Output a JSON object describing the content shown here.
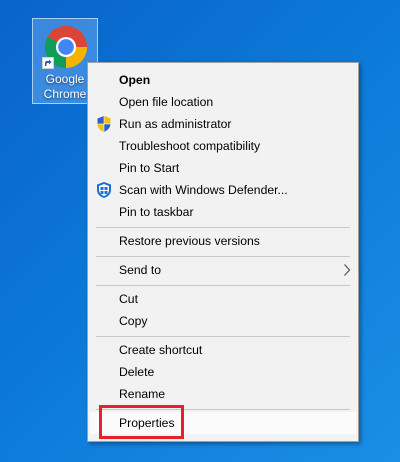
{
  "desktop": {
    "shortcut": {
      "label": "Google\nChrome",
      "icon": "chrome-icon",
      "overlay_icon": "shortcut-arrow-icon"
    }
  },
  "context_menu": {
    "items": [
      {
        "label": "Open",
        "bold": true
      },
      {
        "label": "Open file location"
      },
      {
        "label": "Run as administrator",
        "icon": "uac-shield-icon"
      },
      {
        "label": "Troubleshoot compatibility"
      },
      {
        "label": "Pin to Start"
      },
      {
        "label": "Scan with Windows Defender...",
        "icon": "windows-defender-icon"
      },
      {
        "label": "Pin to taskbar"
      },
      {
        "label": "Restore previous versions"
      },
      {
        "label": "Send to",
        "submenu": true
      },
      {
        "label": "Cut"
      },
      {
        "label": "Copy"
      },
      {
        "label": "Create shortcut"
      },
      {
        "label": "Delete"
      },
      {
        "label": "Rename"
      },
      {
        "label": "Properties",
        "highlighted": true
      }
    ]
  },
  "colors": {
    "desktop_background": "#0b78d8",
    "menu_background": "#f2f2f2",
    "separator": "#c8c8c8",
    "highlight_outline": "#e4222a"
  }
}
